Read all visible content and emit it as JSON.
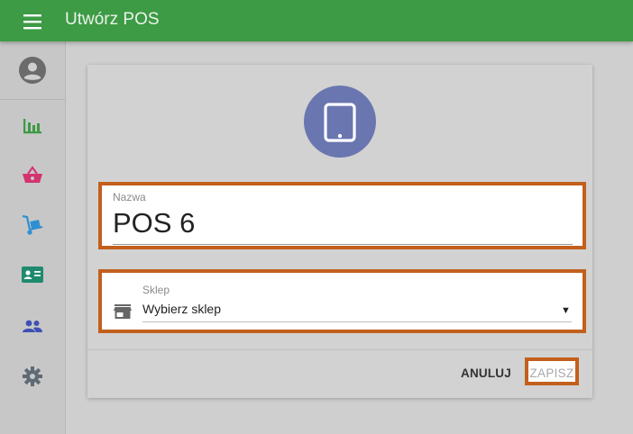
{
  "header": {
    "title": "Utwórz POS",
    "menu_icon": "hamburger-menu-icon",
    "color": "#3d9a45"
  },
  "sidebar": {
    "avatar_icon": "account-circle-icon",
    "items": [
      {
        "icon": "bar-chart-icon",
        "color": "#3d9a45"
      },
      {
        "icon": "shopping-basket-icon",
        "color": "#d3346f"
      },
      {
        "icon": "hand-truck-icon",
        "color": "#2f8fd0"
      },
      {
        "icon": "contact-card-icon",
        "color": "#1e8a6e"
      },
      {
        "icon": "people-icon",
        "color": "#3f51b5"
      },
      {
        "icon": "gear-icon",
        "color": "#5f6a75"
      }
    ]
  },
  "form": {
    "device_icon": "tablet-icon",
    "device_circle_color": "#6a76b0",
    "name_field": {
      "label": "Nazwa",
      "value": "POS 6"
    },
    "shop_field": {
      "icon": "store-icon",
      "label": "Sklep",
      "selected": "Wybierz sklep",
      "dropdown_icon": "dropdown-arrow-icon"
    },
    "highlight_color": "#c25f1d"
  },
  "actions": {
    "cancel_label": "ANULUJ",
    "save_label": "ZAPISZ"
  }
}
